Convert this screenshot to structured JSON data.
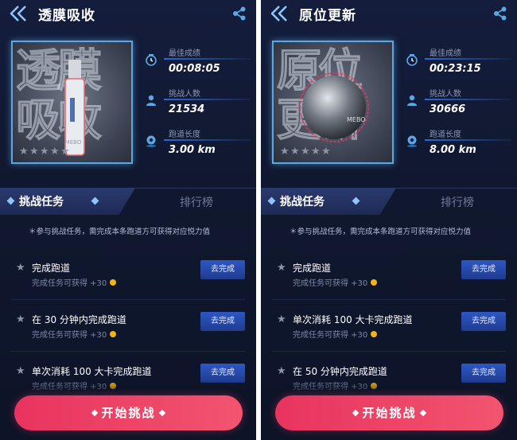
{
  "screens": [
    {
      "title": "透膜吸收",
      "hero_text": "透膜吸收",
      "hero_object": "bottle",
      "rating_stars": 5,
      "stats": [
        {
          "label": "最佳成绩",
          "value": "00:08:05",
          "icon": "trophy-icon"
        },
        {
          "label": "挑战人数",
          "value": "21534",
          "icon": "person-icon"
        },
        {
          "label": "跑道长度",
          "value": "3.00 km",
          "icon": "location-icon"
        }
      ],
      "tabs": {
        "active": "挑战任务",
        "inactive": "排行榜"
      },
      "note": "＊参与挑战任务，需完成本条跑道方可获得对应悦力值",
      "tasks": [
        {
          "title": "完成跑道",
          "reward": "完成任务可获得 +30",
          "button": "去完成"
        },
        {
          "title": "在 30 分钟内完成跑道",
          "reward": "完成任务可获得 +30",
          "button": "去完成"
        },
        {
          "title": "单次消耗 100 大卡完成跑道",
          "reward": "完成任务可获得 +30",
          "button": "去完成"
        }
      ],
      "start_button": "开始挑战"
    },
    {
      "title": "原位更新",
      "hero_text": "原位更新",
      "hero_object": "sphere",
      "rating_stars": 5,
      "stats": [
        {
          "label": "最佳成绩",
          "value": "00:23:15",
          "icon": "trophy-icon"
        },
        {
          "label": "挑战人数",
          "value": "30666",
          "icon": "person-icon"
        },
        {
          "label": "跑道长度",
          "value": "8.00 km",
          "icon": "location-icon"
        }
      ],
      "tabs": {
        "active": "挑战任务",
        "inactive": "排行榜"
      },
      "note": "＊参与挑战任务，需完成本条跑道方可获得对应悦力值",
      "tasks": [
        {
          "title": "完成跑道",
          "reward": "完成任务可获得 +30",
          "button": "去完成"
        },
        {
          "title": "单次消耗 100 大卡完成跑道",
          "reward": "完成任务可获得 +30",
          "button": "去完成"
        },
        {
          "title": "在 50 分钟内完成跑道",
          "reward": "完成任务可获得 +30",
          "button": "去完成"
        }
      ],
      "start_button": "开始挑战"
    }
  ],
  "hero_labels": {
    "bottle": "MEBO",
    "sphere": "MEBO"
  },
  "colors": {
    "accent": "#2e57c4",
    "start": "#e8345f",
    "coin": "#f0b419",
    "background": "#10182f"
  }
}
